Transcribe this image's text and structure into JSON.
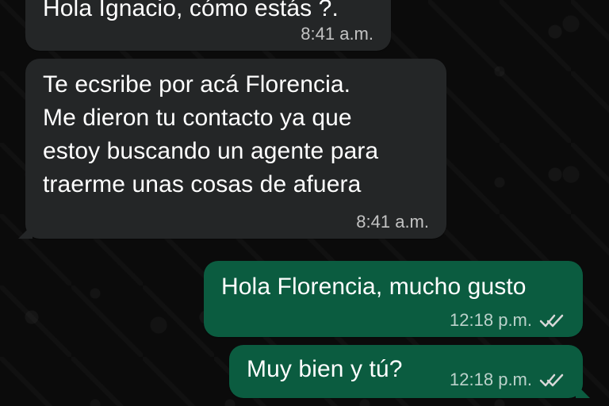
{
  "messages": [
    {
      "text": "Hola Ignacio, cómo estás ?.",
      "time": "8:41 a.m."
    },
    {
      "text": "Te ecsribe por acá Florencia.\nMe dieron tu contacto ya que\nestoy buscando un agente para\ntraerme unas cosas de afuera",
      "time": "8:41 a.m."
    },
    {
      "text": "Hola Florencia, mucho gusto",
      "time": "12:18 p.m."
    },
    {
      "text": "Muy bien y tú?",
      "time": "12:18 p.m."
    }
  ],
  "icons": {
    "read_status": "double-check-icon"
  },
  "colors": {
    "background": "#0b0b0b",
    "incoming_bubble": "#242627",
    "outgoing_bubble": "#0b5c40",
    "meta_text": "#b8b8b8"
  }
}
